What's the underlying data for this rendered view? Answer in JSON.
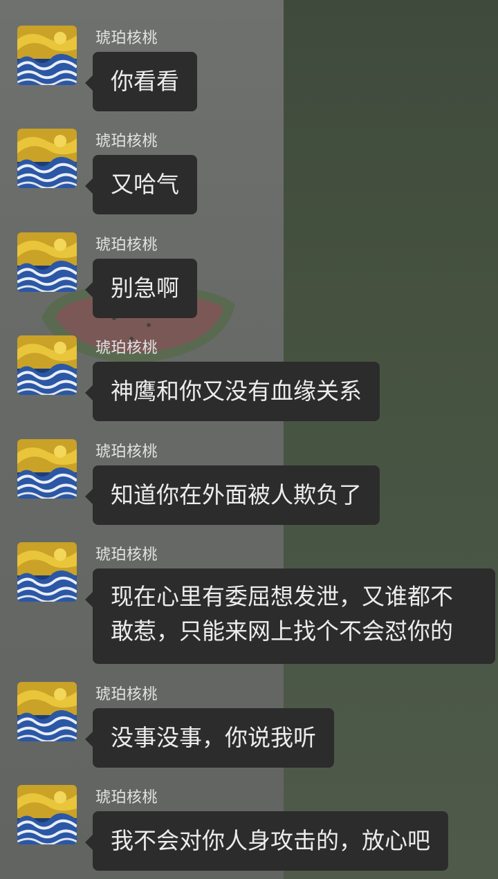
{
  "colors": {
    "bubble": "#2c2c2c",
    "bubble_text": "#ececec",
    "name_text": "#e2e2e2",
    "bg_left": "#6a6c6a",
    "bg_right": "#46523f"
  },
  "messages": [
    {
      "sender": "琥珀核桃",
      "avatar": "starry-night-wave-avatar-icon",
      "text": "你看看"
    },
    {
      "sender": "琥珀核桃",
      "avatar": "starry-night-wave-avatar-icon",
      "text": "又哈气"
    },
    {
      "sender": "琥珀核桃",
      "avatar": "starry-night-wave-avatar-icon",
      "text": "别急啊"
    },
    {
      "sender": "琥珀核桃",
      "avatar": "starry-night-wave-avatar-icon",
      "text": "神鹰和你又没有血缘关系"
    },
    {
      "sender": "琥珀核桃",
      "avatar": "starry-night-wave-avatar-icon",
      "text": "知道你在外面被人欺负了"
    },
    {
      "sender": "琥珀核桃",
      "avatar": "starry-night-wave-avatar-icon",
      "lines": [
        "现在心里有委屈想发泄，又谁都不",
        "敢惹，只能来网上找个不会怼你的"
      ]
    },
    {
      "sender": "琥珀核桃",
      "avatar": "starry-night-wave-avatar-icon",
      "text": "没事没事，你说我听"
    },
    {
      "sender": "琥珀核桃",
      "avatar": "starry-night-wave-avatar-icon",
      "text": "我不会对你人身攻击的，放心吧"
    }
  ]
}
